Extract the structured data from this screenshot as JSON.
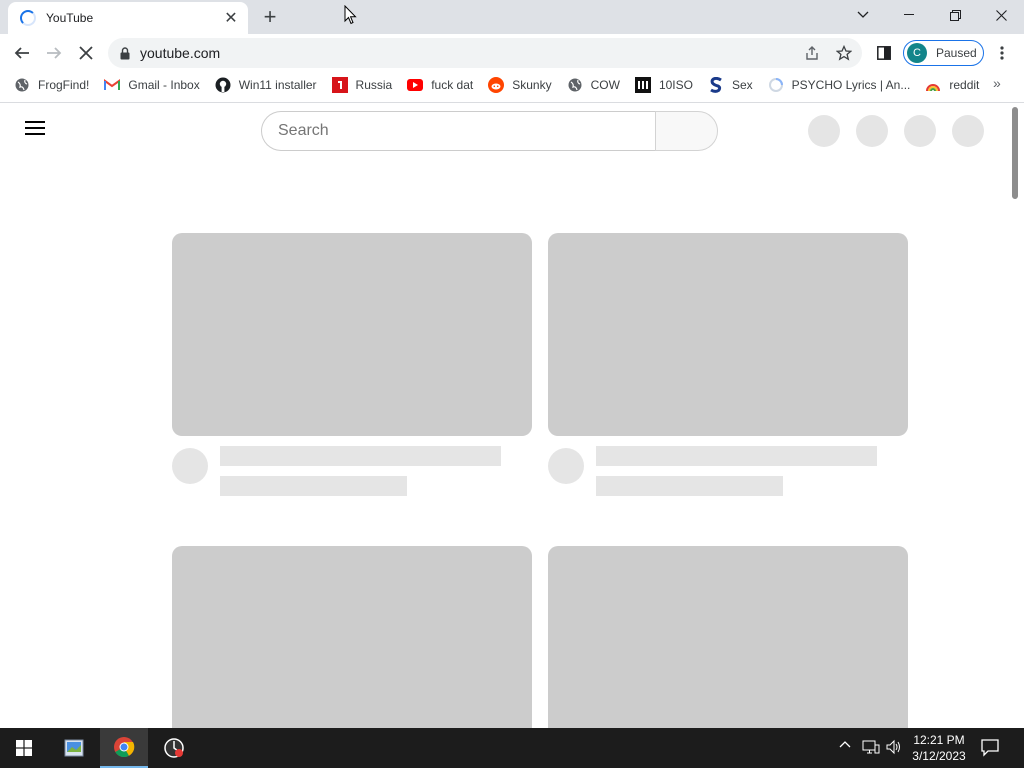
{
  "browser": {
    "tab_title": "YouTube",
    "new_tab_symbol": "+",
    "url": "youtube.com",
    "profile_initial": "C",
    "profile_status": "Paused",
    "bookmarks_overflow": "»",
    "bookmarks": [
      {
        "label": "FrogFind!",
        "icon": "globe-icon"
      },
      {
        "label": "Gmail - Inbox",
        "icon": "gmail-icon"
      },
      {
        "label": "Win11 installer",
        "icon": "github-icon"
      },
      {
        "label": "Russia",
        "icon": "flag-icon"
      },
      {
        "label": "fuck dat",
        "icon": "youtube-icon"
      },
      {
        "label": "Skunky",
        "icon": "reddit-icon"
      },
      {
        "label": "COW",
        "icon": "globe-icon"
      },
      {
        "label": "10ISO",
        "icon": "museum-icon"
      },
      {
        "label": "Sex",
        "icon": "s-icon"
      },
      {
        "label": "PSYCHO Lyrics | An...",
        "icon": "spinner-icon"
      },
      {
        "label": "reddit",
        "icon": "rainbow-icon"
      }
    ]
  },
  "youtube": {
    "search_placeholder": "Search"
  },
  "taskbar": {
    "time": "12:21 PM",
    "date": "3/12/2023"
  },
  "colors": {
    "accent": "#1a73e8",
    "placeholder_dark": "#cccccc",
    "placeholder_light": "#e5e5e5",
    "taskbar": "#1c1c1c"
  }
}
